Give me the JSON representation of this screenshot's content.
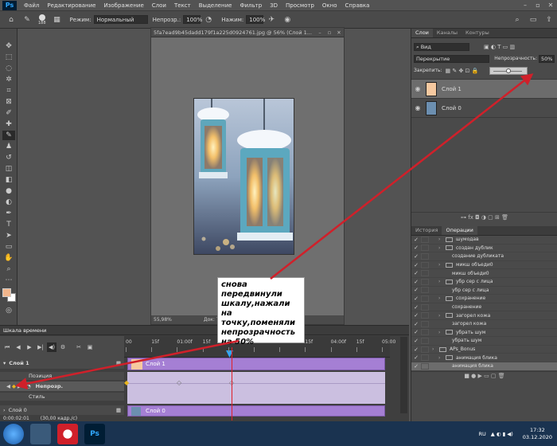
{
  "app": {
    "logo": "Ps"
  },
  "menu": [
    "Файл",
    "Редактирование",
    "Изображение",
    "Слои",
    "Текст",
    "Выделение",
    "Фильтр",
    "3D",
    "Просмотр",
    "Окно",
    "Справка"
  ],
  "options": {
    "brush_size": "188",
    "mode_label": "Режим:",
    "mode_value": "Нормальный",
    "opacity_label": "Непрозр.:",
    "opacity_value": "100%",
    "flow_label": "Нажим:",
    "flow_value": "100%"
  },
  "document": {
    "title": "5fa7ead9b45dadd179f1a225d0924761.jpg @ 56% (Слой 1...",
    "zoom": "55,98%",
    "doc_info": "Док: 796,8К"
  },
  "annotation": {
    "text": "снова передвинули шкалу,нажали на точку,поменяли непрозрачность на 50%"
  },
  "layers_panel": {
    "tabs": [
      "Слои",
      "Каналы",
      "Контуры"
    ],
    "kind_filter": "Вид",
    "blend_mode": "Перекрытие",
    "opacity_label": "Непрозрачность:",
    "opacity_value": "50%",
    "lock_label": "Закрепить:",
    "layers": [
      {
        "name": "Слой 1",
        "selected": true
      },
      {
        "name": "Слой 0",
        "selected": false
      }
    ]
  },
  "actions_panel": {
    "tabs": [
      "История",
      "Операции"
    ],
    "items": [
      {
        "label": "шумодав",
        "indent": 1,
        "folder": true,
        "checked": true
      },
      {
        "label": "создан дублик",
        "indent": 1,
        "folder": true,
        "checked": true
      },
      {
        "label": "создание дубликата",
        "indent": 2,
        "folder": false,
        "checked": true
      },
      {
        "label": "микш объеди0",
        "indent": 1,
        "folder": true,
        "checked": true
      },
      {
        "label": "микш объеди0",
        "indent": 2,
        "folder": false,
        "checked": true
      },
      {
        "label": "убр сер с лица",
        "indent": 1,
        "folder": true,
        "checked": true
      },
      {
        "label": "убр сер с лица",
        "indent": 2,
        "folder": false,
        "checked": true
      },
      {
        "label": "сохранение",
        "indent": 1,
        "folder": true,
        "checked": true
      },
      {
        "label": "сохранение",
        "indent": 2,
        "folder": false,
        "checked": true
      },
      {
        "label": "загорел кожа",
        "indent": 1,
        "folder": true,
        "checked": true
      },
      {
        "label": "загорел кожа",
        "indent": 2,
        "folder": false,
        "checked": true
      },
      {
        "label": "убрать шум",
        "indent": 1,
        "folder": true,
        "checked": true
      },
      {
        "label": "убрать шум",
        "indent": 2,
        "folder": false,
        "checked": true
      },
      {
        "label": "APs_Bonus",
        "indent": 0,
        "folder": true,
        "checked": true
      },
      {
        "label": "анимация блика",
        "indent": 1,
        "folder": true,
        "checked": true
      },
      {
        "label": "анимация блика",
        "indent": 2,
        "folder": false,
        "checked": true
      }
    ]
  },
  "timeline": {
    "tab": "Шкала времени",
    "ruler": [
      "00",
      "15f",
      "01:00f",
      "15f",
      "02:00f",
      "15f",
      "03:00f",
      "15f",
      "04:00f",
      "15f",
      "05:00"
    ],
    "layer1": "Слой 1",
    "pos_label": "Позиция",
    "opacity_label": "Непрозр.",
    "style_label": "Стиль",
    "layer0": "Слой 0",
    "track1": "Слой 1",
    "track0": "Слой 0",
    "timecode": "0:00:02:01",
    "fps": "(30,00 кадр./с)"
  },
  "taskbar": {
    "lang": "RU",
    "time": "17:32",
    "date": "03.12.2020"
  },
  "colors": {
    "accent": "#31a8ff",
    "track": "#a57fd4",
    "arrow": "#d0202a",
    "playhead": "#e0202a"
  }
}
